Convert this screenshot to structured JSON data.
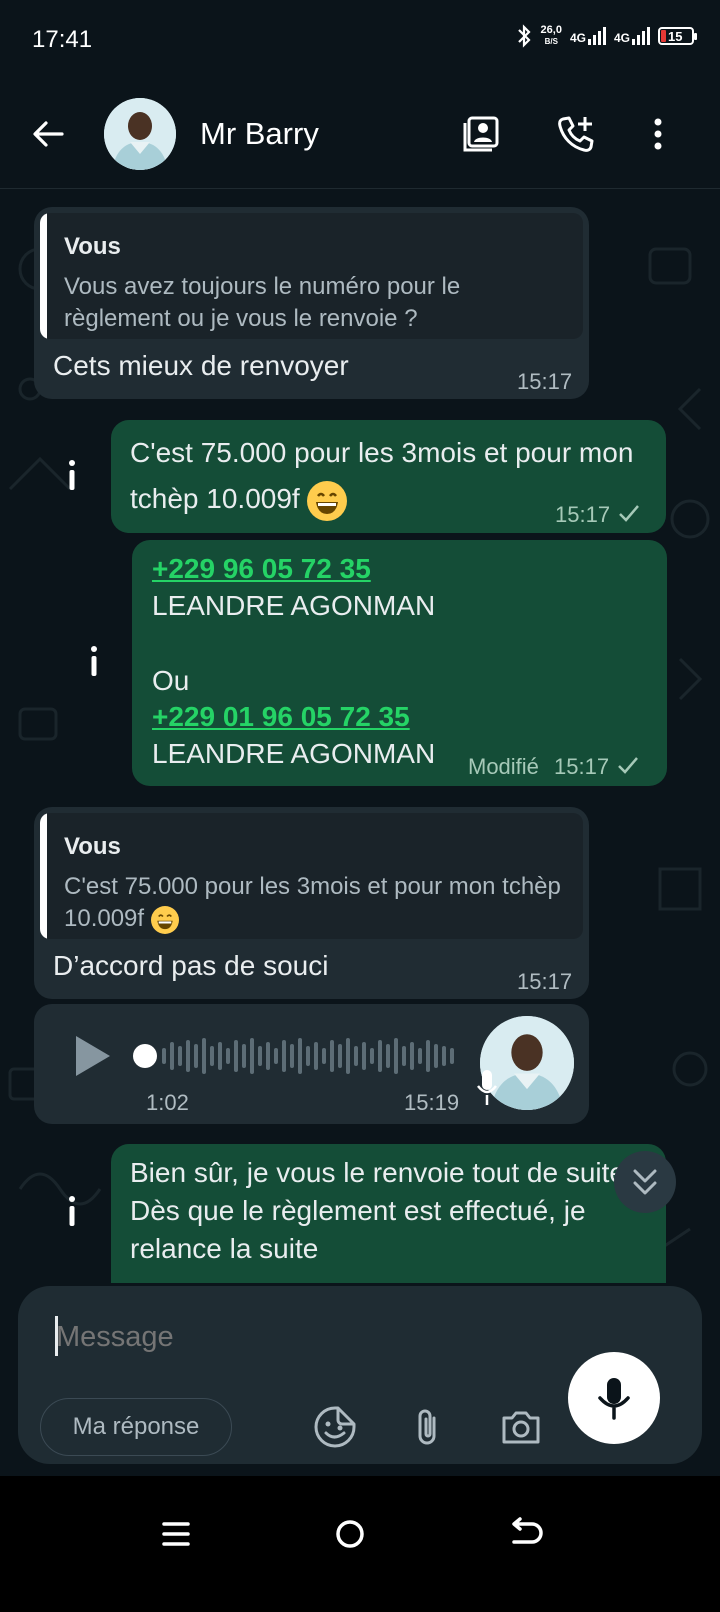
{
  "status_bar": {
    "time": "17:41",
    "speed_value": "26,0",
    "speed_unit": "B/S",
    "net1": "4G",
    "net2": "4G",
    "battery": "15"
  },
  "header": {
    "contact_name": "Mr Barry",
    "icons": [
      "back-arrow-icon",
      "contact-card-icon",
      "add-call-icon",
      "more-vert-icon"
    ]
  },
  "messages": {
    "m1": {
      "quote_author": "Vous",
      "quote_text": "Vous avez toujours le numéro pour le règlement ou je vous le renvoie ?",
      "text": "Cets mieux de renvoyer",
      "time": "15:17"
    },
    "m2": {
      "text": "C'est 75.000 pour les 3mois et pour mon tchèp 10.009f",
      "time": "15:17"
    },
    "m3": {
      "phone1": "+229 96 05 72 35",
      "name1": "LEANDRE AGONMAN",
      "ou": "Ou",
      "phone2": "+229 01 96 05 72 35",
      "name2": "LEANDRE AGONMAN",
      "edited": "Modifié",
      "time": "15:17"
    },
    "m4": {
      "quote_author": "Vous",
      "quote_text": "C'est 75.000 pour les 3mois et pour mon tchèp 10.009f",
      "text": "D’accord pas de souci",
      "time": "15:17"
    },
    "m5": {
      "duration": "1:02",
      "time": "15:19"
    },
    "m6": {
      "text": "Bien sûr, je vous le renvoie tout de suite. Dès que le règlement est effectué, je relance la suite"
    }
  },
  "composer": {
    "placeholder": "Message",
    "reply_chip": "Ma réponse",
    "icons": [
      "sticker-icon",
      "attach-icon",
      "camera-icon",
      "mic-icon"
    ]
  },
  "colors": {
    "background": "#0b141a",
    "incoming": "#202c33",
    "outgoing": "#144d37",
    "link": "#25d366"
  }
}
